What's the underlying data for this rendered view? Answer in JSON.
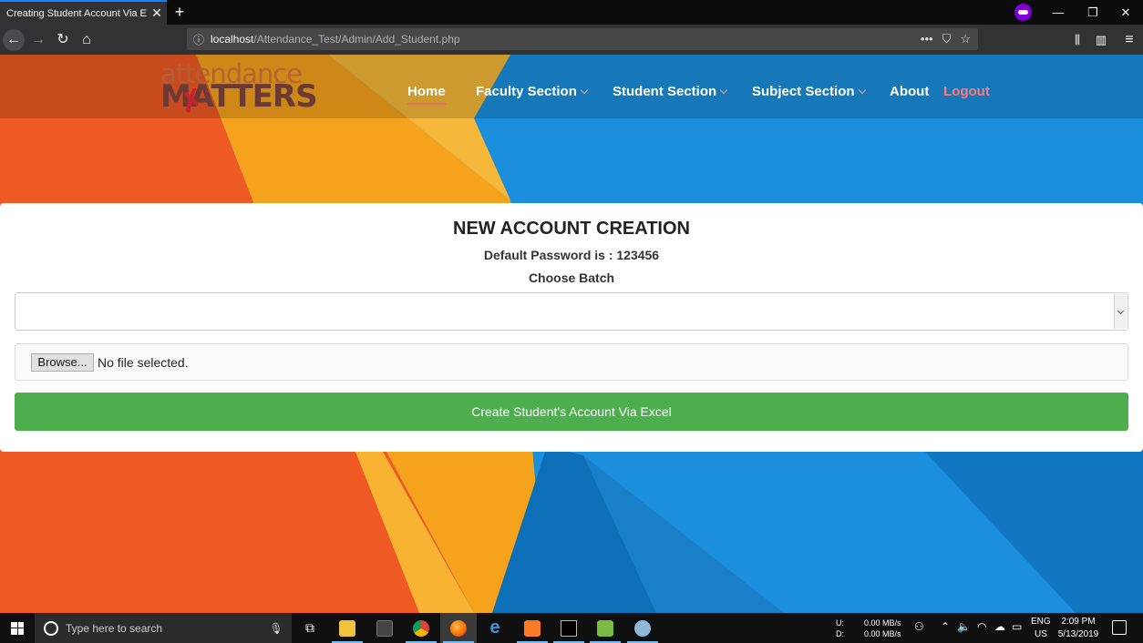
{
  "browser": {
    "tab_title": "Creating Student Account Via Excel",
    "tab_close": "✕",
    "new_tab": "+",
    "url_host": "localhost",
    "url_path": "/Attendance_Test/Admin/Add_Student.php",
    "win_minimize": "—",
    "win_restore": "❐",
    "win_close": "✕"
  },
  "site": {
    "logo_line1": "attendance",
    "logo_line2": "MATTERS",
    "nav": {
      "home": "Home",
      "faculty": "Faculty Section",
      "student": "Student Section",
      "subject": "Subject Section",
      "about": "About",
      "logout": "Logout"
    }
  },
  "form": {
    "title": "NEW ACCOUNT CREATION",
    "default_password": "Default Password is : 123456",
    "choose_batch": "Choose Batch",
    "batch_value": "",
    "browse_label": "Browse...",
    "file_status": "No file selected.",
    "submit_label": "Create Student's Account Via Excel"
  },
  "taskbar": {
    "search_placeholder": "Type here to search",
    "net_up_label": "U:",
    "net_down_label": "D:",
    "net_up": "0.00 MB/s",
    "net_down": "0.00 MB/s",
    "lang": "ENG",
    "region": "US",
    "time": "2:09 PM",
    "date": "5/13/2019"
  },
  "colors": {
    "accent_green": "#4cae4c",
    "logout_red": "#ff7b7b",
    "firefox_private": "#8000d7"
  }
}
